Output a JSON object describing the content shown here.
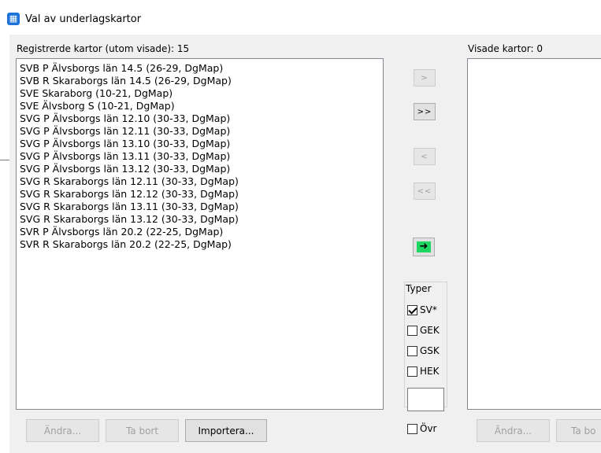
{
  "window": {
    "title": "Val av underlagskartor",
    "icon": "app-map-icon"
  },
  "left_panel": {
    "label": "Registrerde kartor (utom visade): 15",
    "items": [
      "SVB P Älvsborgs län 14.5 (26-29, DgMap)",
      "SVB R Skaraborgs län 14.5 (26-29, DgMap)",
      "SVE Skaraborg (10-21, DgMap)",
      "SVE Älvsborg S (10-21, DgMap)",
      "SVG P Älvsborgs län 12.10 (30-33, DgMap)",
      "SVG P Älvsborgs län 12.11 (30-33, DgMap)",
      "SVG P Älvsborgs län 13.10 (30-33, DgMap)",
      "SVG P Älvsborgs län 13.11 (30-33, DgMap)",
      "SVG P Älvsborgs län 13.12 (30-33, DgMap)",
      "SVG R Skaraborgs län 12.11 (30-33, DgMap)",
      "SVG R Skaraborgs län 12.12 (30-33, DgMap)",
      "SVG R Skaraborgs län 13.11 (30-33, DgMap)",
      "SVG R Skaraborgs län 13.12 (30-33, DgMap)",
      "SVR P Älvsborgs län 20.2 (22-25, DgMap)",
      "SVR R Skaraborgs län 20.2 (22-25, DgMap)"
    ],
    "buttons": {
      "edit": "Ändra...",
      "remove": "Ta bort",
      "import": "Importera..."
    }
  },
  "middle": {
    "move_right": ">",
    "move_all_right": ">>",
    "move_left": "<",
    "move_all_left": "<<",
    "go_icon": "arrow-right-icon",
    "go_glyph": "➜",
    "accent": "#1ed760",
    "typer": {
      "label": "Typer",
      "sv": {
        "label": "SV*",
        "checked": true
      },
      "gek": {
        "label": "GEK",
        "checked": false
      },
      "gsk": {
        "label": "GSK",
        "checked": false
      },
      "hek": {
        "label": "HEK",
        "checked": false
      },
      "custom_value": "",
      "ovr": {
        "label": "Övr",
        "checked": false
      }
    }
  },
  "right_panel": {
    "label": "Visade kartor: 0",
    "items": [],
    "buttons": {
      "edit": "Ändra...",
      "remove": "Ta bo"
    }
  }
}
